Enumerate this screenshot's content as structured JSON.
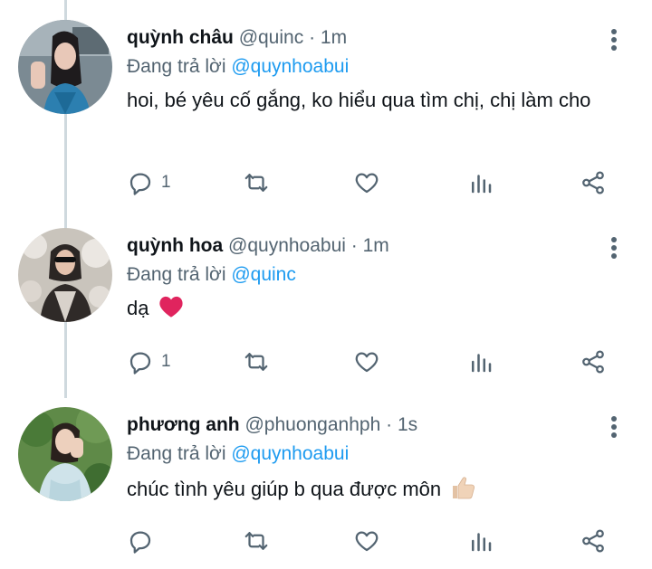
{
  "colors": {
    "text": "#0f1419",
    "secondary": "#536471",
    "link": "#1d9bf0",
    "thread_line": "#cfd9de",
    "heart": "#e0245e"
  },
  "tweets": [
    {
      "name": "quỳnh châu",
      "handle": "@quinc",
      "separator": "·",
      "time": "1m",
      "reply_prefix": "Đang trả lời",
      "reply_to": "@quynhoabui",
      "text": "hoi, bé yêu cố gắng, ko hiểu qua tìm chị, chị làm cho",
      "emoji": "",
      "reply_count": "1"
    },
    {
      "name": "quỳnh hoa",
      "handle": "@quynhoabui",
      "separator": "·",
      "time": "1m",
      "reply_prefix": "Đang trả lời",
      "reply_to": "@quinc",
      "text": "dạ",
      "emoji": "red-heart-emoji",
      "reply_count": "1"
    },
    {
      "name": "phương anh",
      "handle": "@phuonganhph",
      "separator": "·",
      "time": "1s",
      "reply_prefix": "Đang trả lời",
      "reply_to": "@quynhoabui",
      "text": "chúc tình yêu giúp b qua được môn",
      "emoji": "thumbs-up-emoji",
      "reply_count": ""
    }
  ],
  "icons": {
    "reply": "comment-icon",
    "retweet": "retweet-icon",
    "like": "heart-icon",
    "views": "bar-chart-icon",
    "share": "share-icon",
    "more": "more-vertical-icon"
  }
}
